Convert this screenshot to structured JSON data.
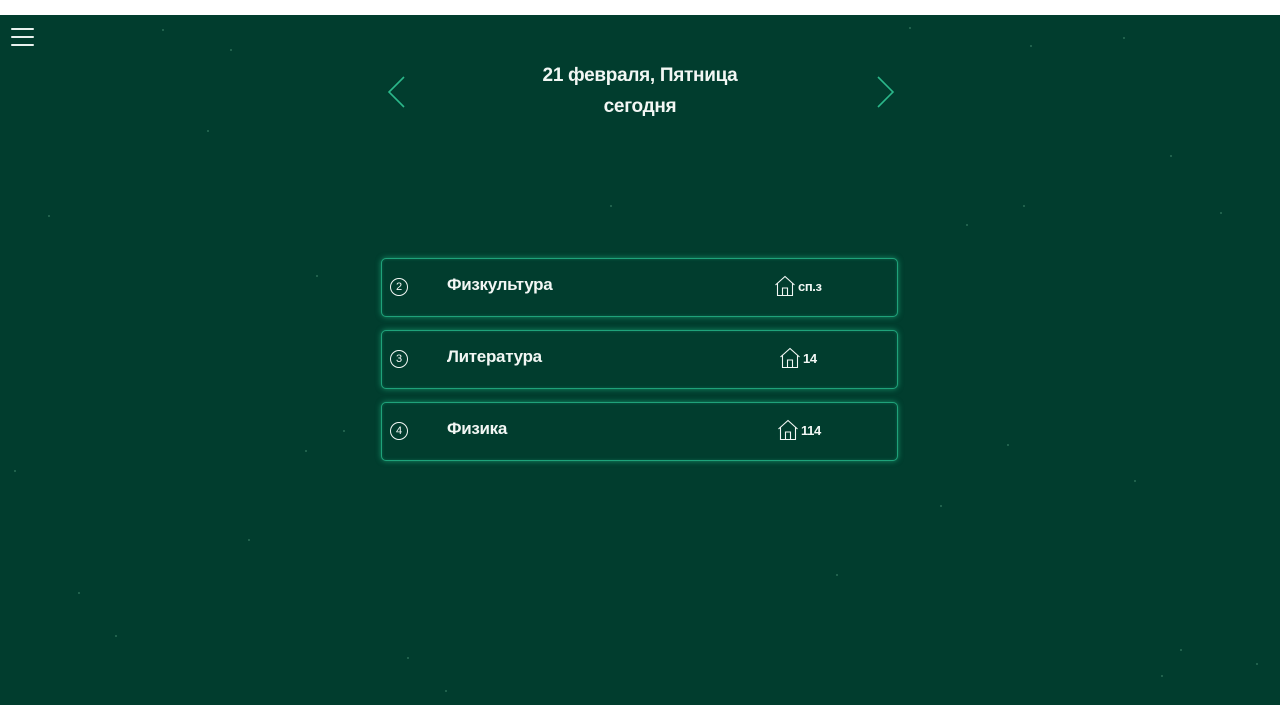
{
  "header": {
    "date": "21 февраля, Пятница",
    "relative_day": "сегодня"
  },
  "navigation": {
    "menu_icon": "hamburger-menu-icon",
    "prev_icon": "chevron-left-icon",
    "next_icon": "chevron-right-icon"
  },
  "lessons": [
    {
      "number": "2",
      "subject": "Физкультура",
      "room_icon": "house-icon",
      "room": "сп.з"
    },
    {
      "number": "3",
      "subject": "Литература",
      "room_icon": "house-icon",
      "room": "14"
    },
    {
      "number": "4",
      "subject": "Физика",
      "room_icon": "house-icon",
      "room": "114"
    }
  ],
  "colors": {
    "background": "#013d2e",
    "card_border": "#1fa27a",
    "text": "#f2f7f4",
    "accent": "#2bb88a"
  }
}
